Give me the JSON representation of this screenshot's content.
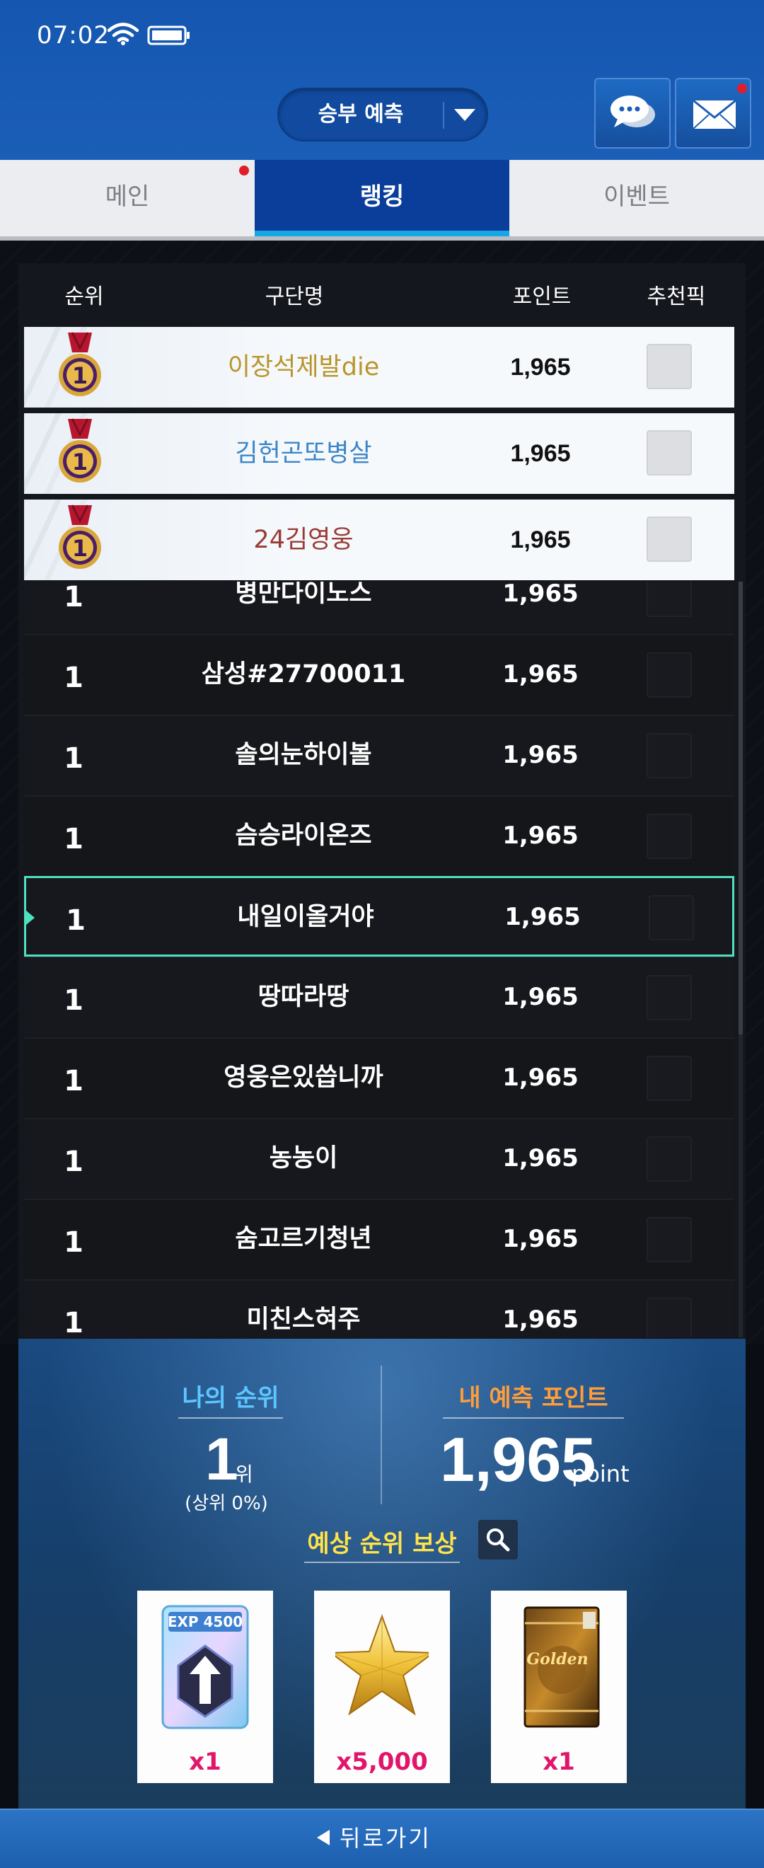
{
  "status_bar": {
    "time": "07:02",
    "wifi_icon": "wifi-icon",
    "battery_icon": "battery-icon"
  },
  "header": {
    "mode_select": {
      "selected": "승부 예측",
      "icon": "chevron-down-icon"
    },
    "chat_button": {
      "icon": "chat-bubbles-icon"
    },
    "mail_button": {
      "icon": "envelope-icon",
      "has_notification": true
    },
    "colors": {
      "header_blue": "#1557b0",
      "active_tab": "#0b3d9a",
      "notification": "#e01e2b"
    }
  },
  "tabs": [
    {
      "label": "메인",
      "active": false,
      "has_notification": true
    },
    {
      "label": "랭킹",
      "active": true
    },
    {
      "label": "이벤트",
      "active": false
    }
  ],
  "table": {
    "columns": [
      "순위",
      "구단명",
      "포인트",
      "추천픽"
    ],
    "top_rows": [
      {
        "rank_icon": "gold-medal-1-icon",
        "name": "이장석제발die",
        "points": "1,965",
        "name_color": "#b8952b"
      },
      {
        "rank_icon": "gold-medal-1-icon",
        "name": "김헌곤또병살",
        "points": "1,965",
        "name_color": "#3c86c8"
      },
      {
        "rank_icon": "gold-medal-1-icon",
        "name": "24김영웅",
        "points": "1,965",
        "name_color": "#9a3b35"
      }
    ],
    "rows": [
      {
        "rank": "1",
        "name": "병만다이노스",
        "points": "1,965"
      },
      {
        "rank": "1",
        "name": "삼성#27700011",
        "points": "1,965"
      },
      {
        "rank": "1",
        "name": "솔의눈하이볼",
        "points": "1,965"
      },
      {
        "rank": "1",
        "name": "슴승라이온즈",
        "points": "1,965"
      },
      {
        "rank": "1",
        "name": "내일이올거야",
        "points": "1,965",
        "is_me": true
      },
      {
        "rank": "1",
        "name": "땅따라땅",
        "points": "1,965"
      },
      {
        "rank": "1",
        "name": "영웅은있씁니까",
        "points": "1,965"
      },
      {
        "rank": "1",
        "name": "농농이",
        "points": "1,965"
      },
      {
        "rank": "1",
        "name": "숨고르기청년",
        "points": "1,965"
      },
      {
        "rank": "1",
        "name": "미친스혀주",
        "points": "1,965"
      }
    ],
    "highlight_color": "#4fe0c0"
  },
  "my_summary": {
    "rank_title": "나의 순위",
    "rank_value": "1",
    "rank_unit": "위",
    "rank_percent": "(상위 0%)",
    "points_title": "내 예측 포인트",
    "points_value": "1,965",
    "points_unit": "point",
    "title_colors": {
      "rank": "#5cc7ff",
      "points": "#ff9d3a",
      "reward": "#ffe34a"
    }
  },
  "rewards": {
    "title": "예상 순위 보상",
    "search_icon": "magnifier-icon",
    "items": [
      {
        "icon": "exp-card-icon",
        "card_text": "EXP 4500",
        "quantity": "x1"
      },
      {
        "icon": "gold-star-icon",
        "quantity": "x5,000"
      },
      {
        "icon": "card-pack-icon",
        "card_text": "Golden",
        "quantity": "x1"
      }
    ]
  },
  "back_button": {
    "label": "뒤로가기",
    "icon": "back-arrow-icon"
  }
}
